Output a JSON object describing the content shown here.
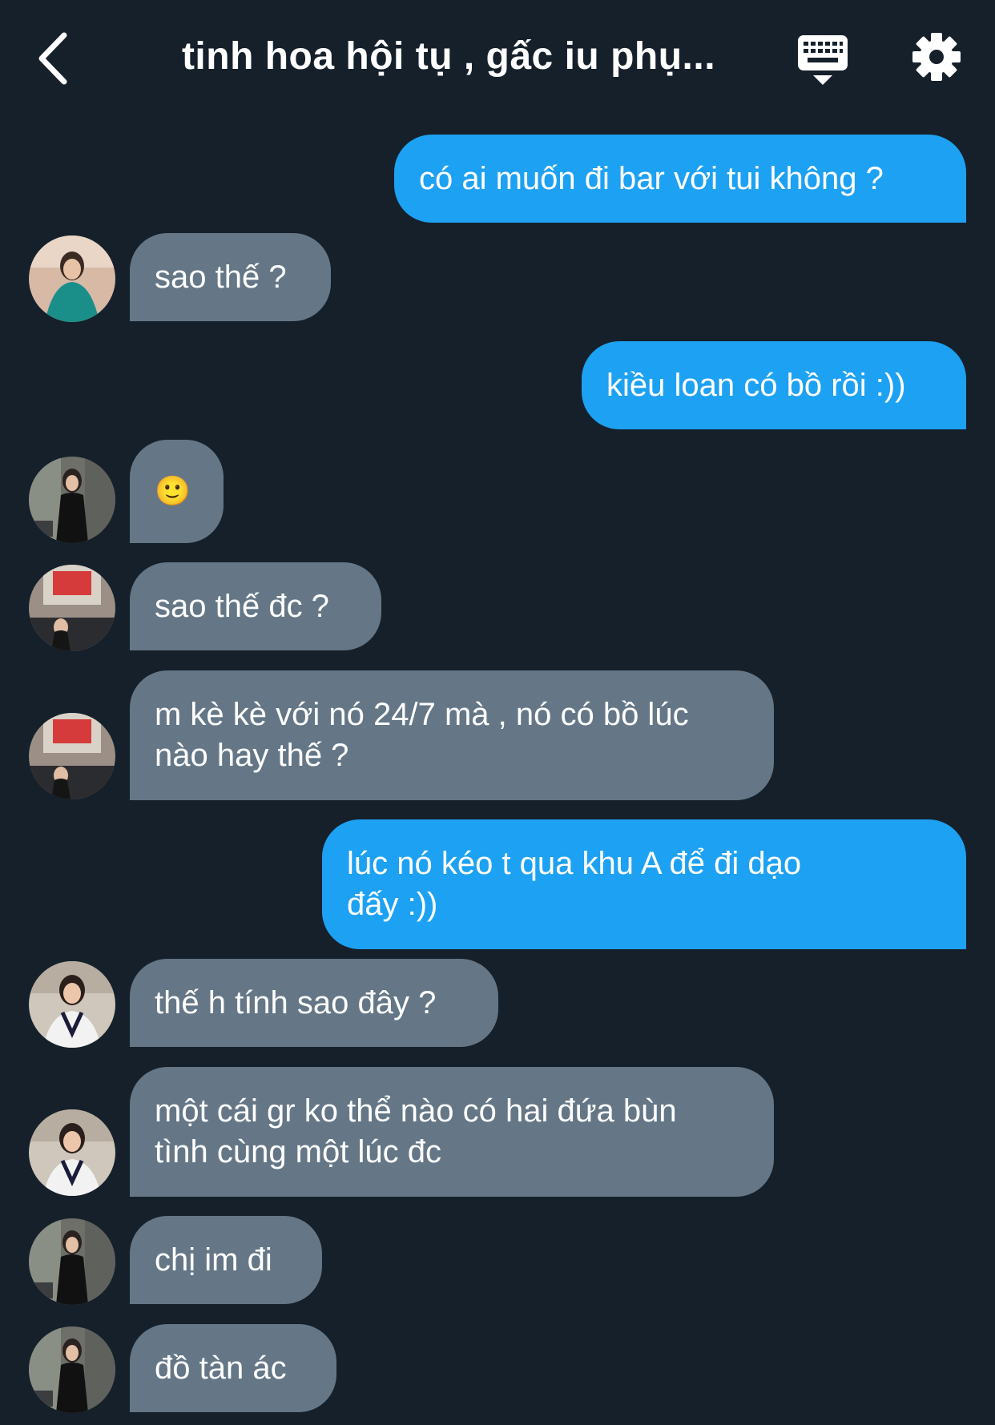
{
  "header": {
    "title": "tinh hoa hội tụ , gấc iu phụ...",
    "back_icon": "chevron-left-icon",
    "keyboard_icon": "keyboard-icon",
    "settings_icon": "gear-icon"
  },
  "colors": {
    "background": "#15202b",
    "outgoing_bubble": "#1da1f2",
    "incoming_bubble": "#657786",
    "text": "#ffffff"
  },
  "messages": [
    {
      "direction": "out",
      "text": "có ai muốn đi bar với tui không ?"
    },
    {
      "direction": "in",
      "text": "sao thế ?",
      "avatar": "avatar-teal-dress"
    },
    {
      "direction": "out",
      "text": "kiều loan có bồ rồi :))"
    },
    {
      "direction": "in",
      "text": "🙂",
      "avatar": "avatar-black-outfit"
    },
    {
      "direction": "in",
      "text": "sao thế đc ?",
      "avatar": "avatar-street-sign"
    },
    {
      "direction": "in",
      "text": "m kè kè với nó 24/7 mà , nó có bồ lúc\nnào hay thế ?",
      "avatar": "avatar-street-sign"
    },
    {
      "direction": "out",
      "text": "lúc nó kéo t qua khu A để đi dạo\nđấy :))"
    },
    {
      "direction": "in",
      "text": "thế h tính sao đây ?",
      "avatar": "avatar-white-vest"
    },
    {
      "direction": "in",
      "text": "một cái gr ko thể nào có hai đứa bùn\ntình cùng một lúc đc",
      "avatar": "avatar-white-vest"
    },
    {
      "direction": "in",
      "text": "chị im đi",
      "avatar": "avatar-black-outfit"
    },
    {
      "direction": "in",
      "text": "đồ tàn ác",
      "avatar": "avatar-black-outfit"
    }
  ]
}
